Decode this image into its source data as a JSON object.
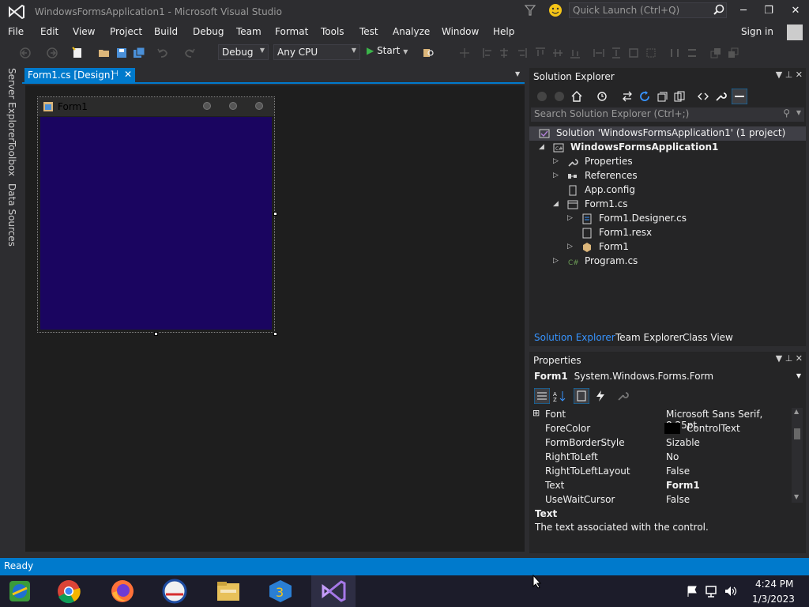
{
  "window": {
    "title": "WindowsFormsApplication1 - Microsoft Visual Studio",
    "quick_launch_placeholder": "Quick Launch (Ctrl+Q)",
    "minimize": "─",
    "restore": "❐",
    "close": "✕"
  },
  "menu": {
    "items": [
      "File",
      "Edit",
      "View",
      "Project",
      "Build",
      "Debug",
      "Team",
      "Format",
      "Tools",
      "Test",
      "Analyze",
      "Window",
      "Help"
    ],
    "sign_in": "Sign in"
  },
  "toolbar": {
    "configuration": "Debug",
    "platform": "Any CPU",
    "start_label": "Start"
  },
  "left_tabs": [
    "Server Explorer",
    "Toolbox",
    "Data Sources"
  ],
  "document": {
    "tab_label": "Form1.cs [Design]",
    "form_caption": "Form1"
  },
  "solution_explorer": {
    "title": "Solution Explorer",
    "search_placeholder": "Search Solution Explorer (Ctrl+;)",
    "tree": [
      {
        "label": "Solution 'WindowsFormsApplication1' (1 project)",
        "icon": "solution-icon",
        "expander": ""
      },
      {
        "label": "WindowsFormsApplication1",
        "icon": "csharp-project-icon",
        "expander": "◢",
        "bold": true
      },
      {
        "label": "Properties",
        "icon": "wrench-icon",
        "expander": "▷"
      },
      {
        "label": "References",
        "icon": "references-icon",
        "expander": "▷"
      },
      {
        "label": "App.config",
        "icon": "config-file-icon",
        "expander": ""
      },
      {
        "label": "Form1.cs",
        "icon": "form-file-icon",
        "expander": "◢"
      },
      {
        "label": "Form1.Designer.cs",
        "icon": "code-file-icon",
        "expander": "▷"
      },
      {
        "label": "Form1.resx",
        "icon": "resx-file-icon",
        "expander": ""
      },
      {
        "label": "Form1",
        "icon": "form-class-icon",
        "expander": "▷"
      },
      {
        "label": "Program.cs",
        "icon": "csharp-file-icon",
        "expander": "▷"
      }
    ],
    "bottom_tabs": [
      "Solution Explorer",
      "Team Explorer",
      "Class View"
    ]
  },
  "properties": {
    "title": "Properties",
    "object_name": "Form1",
    "object_type": "System.Windows.Forms.Form",
    "rows": [
      {
        "name": "Font",
        "value": "Microsoft Sans Serif, 8.25pt",
        "expandable": true
      },
      {
        "name": "ForeColor",
        "value": "ControlText",
        "swatch": "#000000"
      },
      {
        "name": "FormBorderStyle",
        "value": "Sizable"
      },
      {
        "name": "RightToLeft",
        "value": "No"
      },
      {
        "name": "RightToLeftLayout",
        "value": "False"
      },
      {
        "name": "Text",
        "value": "Form1",
        "bold": true
      },
      {
        "name": "UseWaitCursor",
        "value": "False"
      }
    ],
    "description_title": "Text",
    "description_text": "The text associated with the control."
  },
  "status": {
    "text": "Ready"
  },
  "taskbar": {
    "time": "4:24 PM",
    "date": "1/3/2023"
  },
  "colors": {
    "accent": "#007acc",
    "form_background": "#1a0560",
    "ide_background": "#2d2d30",
    "designer_background": "#1e1e1e"
  }
}
